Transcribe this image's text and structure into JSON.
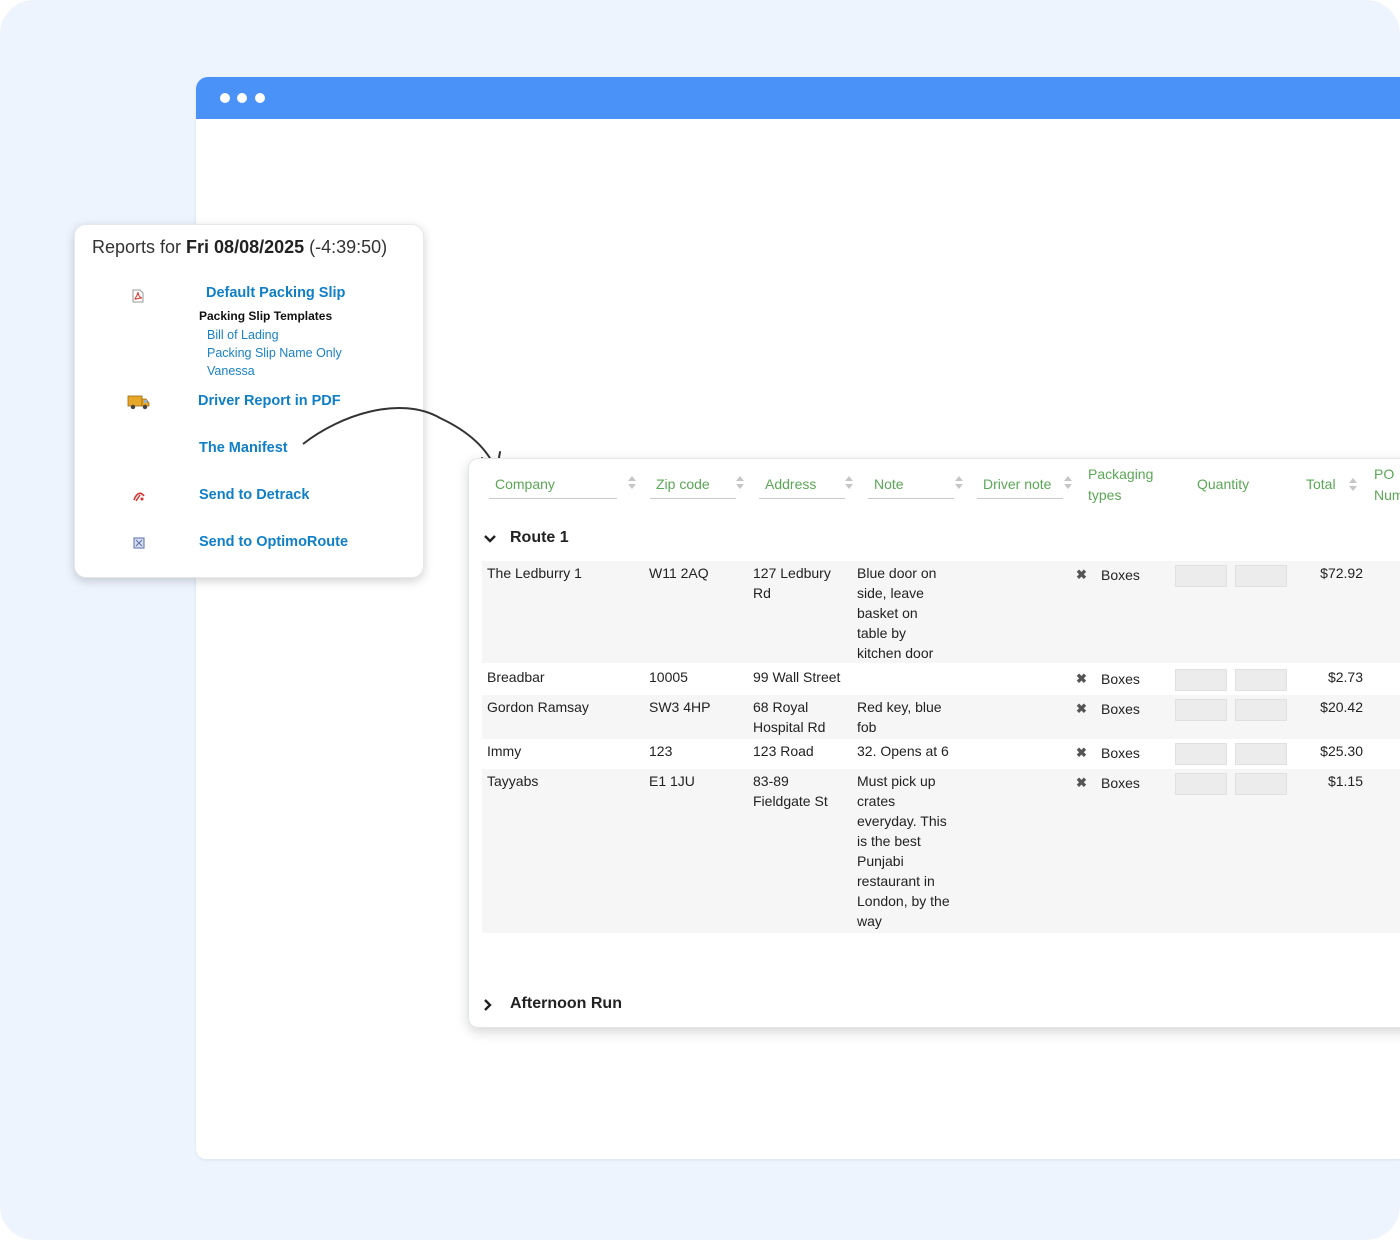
{
  "reports": {
    "title_prefix": "Reports for ",
    "title_date": "Fri 08/08/2025",
    "title_suffix": " (-4:39:50)",
    "default_packing_slip": "Default Packing Slip",
    "packing_slip_templates_label": "Packing Slip Templates",
    "templates": [
      "Bill of Lading",
      "Packing Slip Name Only",
      "Vanessa"
    ],
    "driver_report": "Driver Report in PDF",
    "manifest": "The Manifest",
    "send_detrack": "Send to Detrack",
    "send_optimoroute": "Send to OptimoRoute"
  },
  "manifest": {
    "headers": {
      "company": "Company",
      "zip": "Zip code",
      "address": "Address",
      "note": "Note",
      "driver_note": "Driver note",
      "packaging_line1": "Packaging",
      "packaging_line2": "types",
      "quantity": "Quantity",
      "total": "Total",
      "po_line1": "PO",
      "po_line2": "Num"
    },
    "groups": [
      {
        "title": "Route 1",
        "expanded": true,
        "rows": [
          {
            "company": "The Ledburry 1",
            "zip": "W11 2AQ",
            "address": [
              "127 Ledbury",
              "Rd"
            ],
            "note": [
              "Blue door on",
              "side, leave",
              "basket on",
              "table by",
              "kitchen door"
            ],
            "packaging": "Boxes",
            "total": "$72.92"
          },
          {
            "company": "Breadbar",
            "zip": "10005",
            "address": [
              "99 Wall Street"
            ],
            "note": [],
            "packaging": "Boxes",
            "total": "$2.73"
          },
          {
            "company": "Gordon Ramsay",
            "zip": "SW3 4HP",
            "address": [
              "68 Royal",
              "Hospital Rd"
            ],
            "note": [
              "Red key, blue",
              "fob"
            ],
            "packaging": "Boxes",
            "total": "$20.42"
          },
          {
            "company": "Immy",
            "zip": "123",
            "address": [
              "123 Road"
            ],
            "note": [
              "32. Opens at 6"
            ],
            "packaging": "Boxes",
            "total": "$25.30"
          },
          {
            "company": "Tayyabs",
            "zip": "E1 1JU",
            "address": [
              "83-89",
              "Fieldgate St"
            ],
            "note": [
              "Must pick up",
              "crates",
              "everyday. This",
              "is the best",
              "Punjabi",
              "restaurant in",
              "London, by the",
              "way"
            ],
            "packaging": "Boxes",
            "total": "$1.15"
          }
        ]
      },
      {
        "title": "Afternoon Run",
        "expanded": false,
        "rows": []
      }
    ]
  },
  "colors": {
    "browser_bar": "#4a92f8",
    "header_text": "#5aa855",
    "link": "#0f7fc7"
  }
}
